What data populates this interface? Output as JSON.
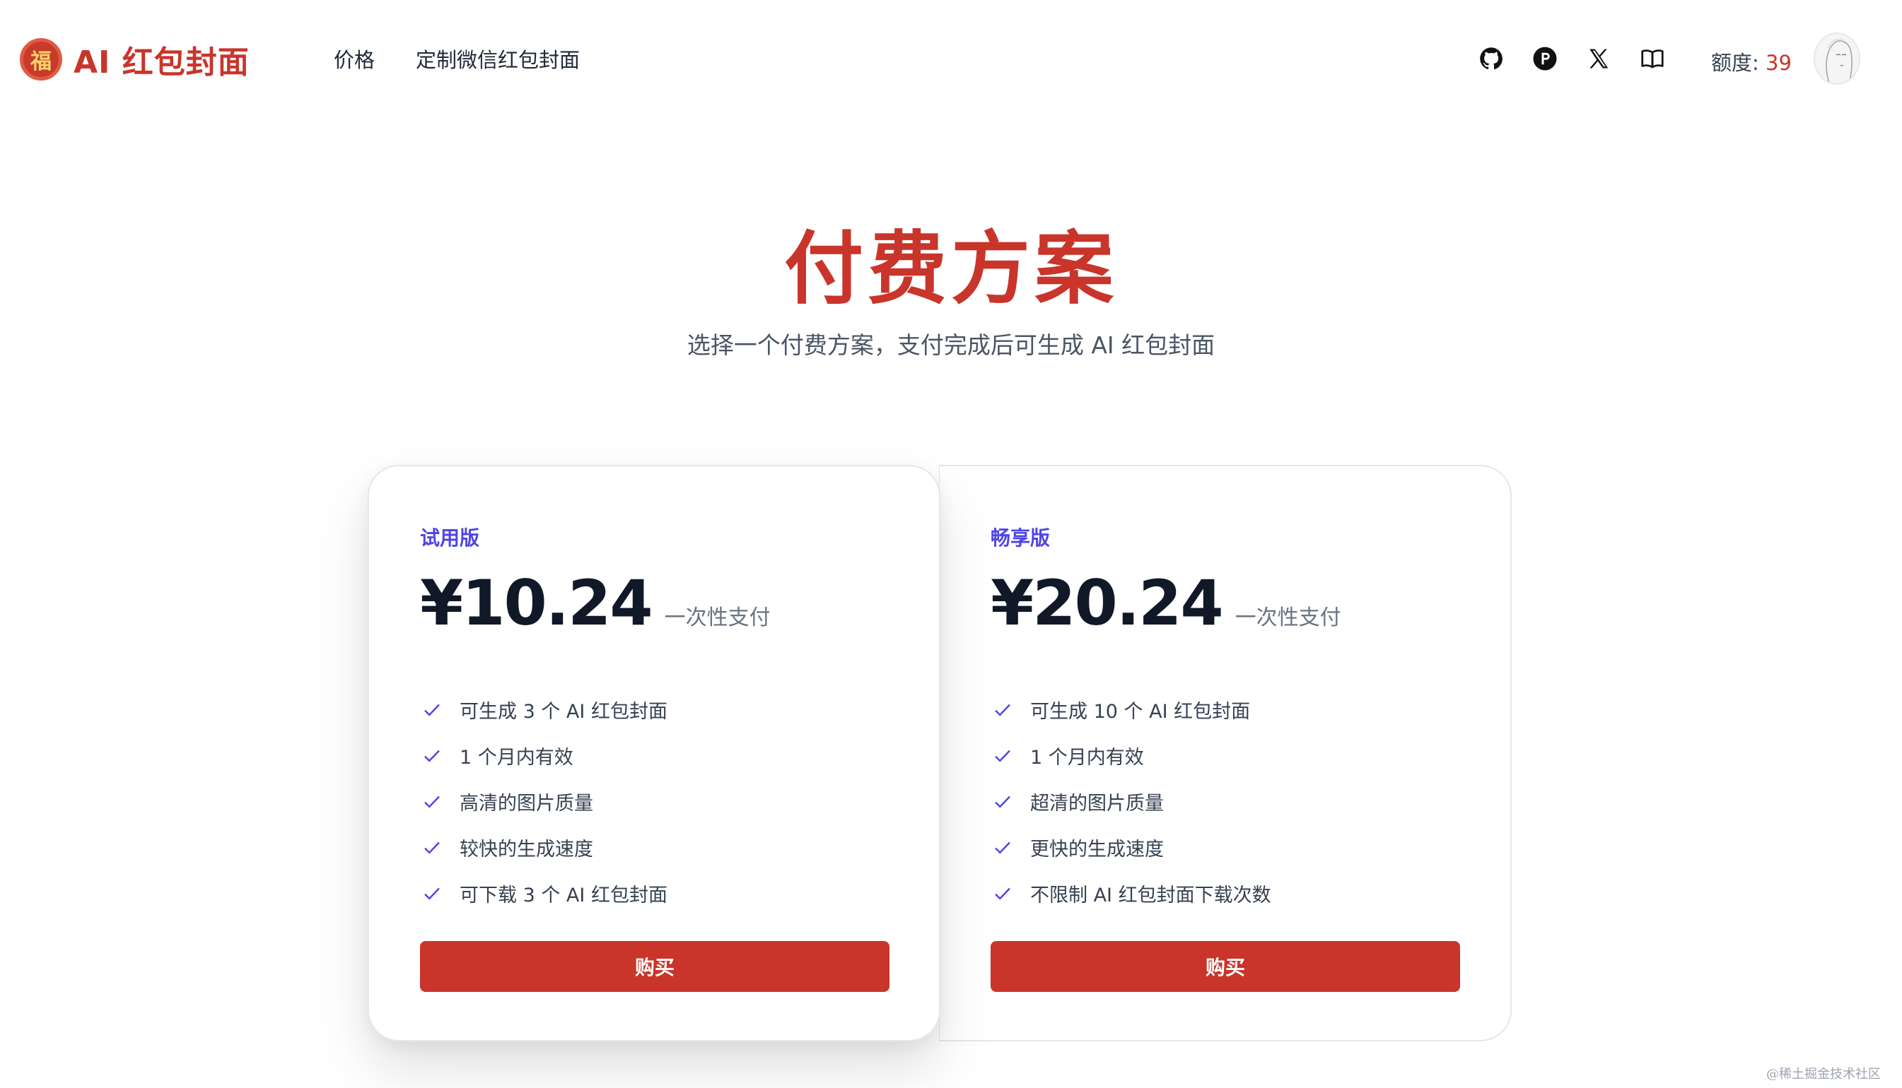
{
  "app": {
    "logo_glyph": "福",
    "name": "AI 红包封面"
  },
  "nav": {
    "items": [
      "价格",
      "定制微信红包封面"
    ]
  },
  "header": {
    "icons": [
      "github-icon",
      "producthunt-icon",
      "x-icon",
      "book-icon"
    ],
    "quota_label": "额度: ",
    "quota_value": "39"
  },
  "hero": {
    "title": "付费方案",
    "subtitle": "选择一个付费方案，支付完成后可生成 AI 红包封面"
  },
  "plans": [
    {
      "name": "试用版",
      "price": "¥10.24",
      "price_note": "一次性支付",
      "features": [
        "可生成 3 个 AI 红包封面",
        "1 个月内有效",
        "高清的图片质量",
        "较快的生成速度",
        "可下载 3 个 AI 红包封面"
      ],
      "button": "购买"
    },
    {
      "name": "畅享版",
      "price": "¥20.24",
      "price_note": "一次性支付",
      "features": [
        "可生成 10 个 AI 红包封面",
        "1 个月内有效",
        "超清的图片质量",
        "更快的生成速度",
        "不限制 AI 红包封面下载次数"
      ],
      "button": "购买"
    }
  ],
  "footer": {
    "watermark": "@稀土掘金技术社区"
  },
  "colors": {
    "brand_red": "#c9352a",
    "accent_indigo": "#4f46e5"
  }
}
